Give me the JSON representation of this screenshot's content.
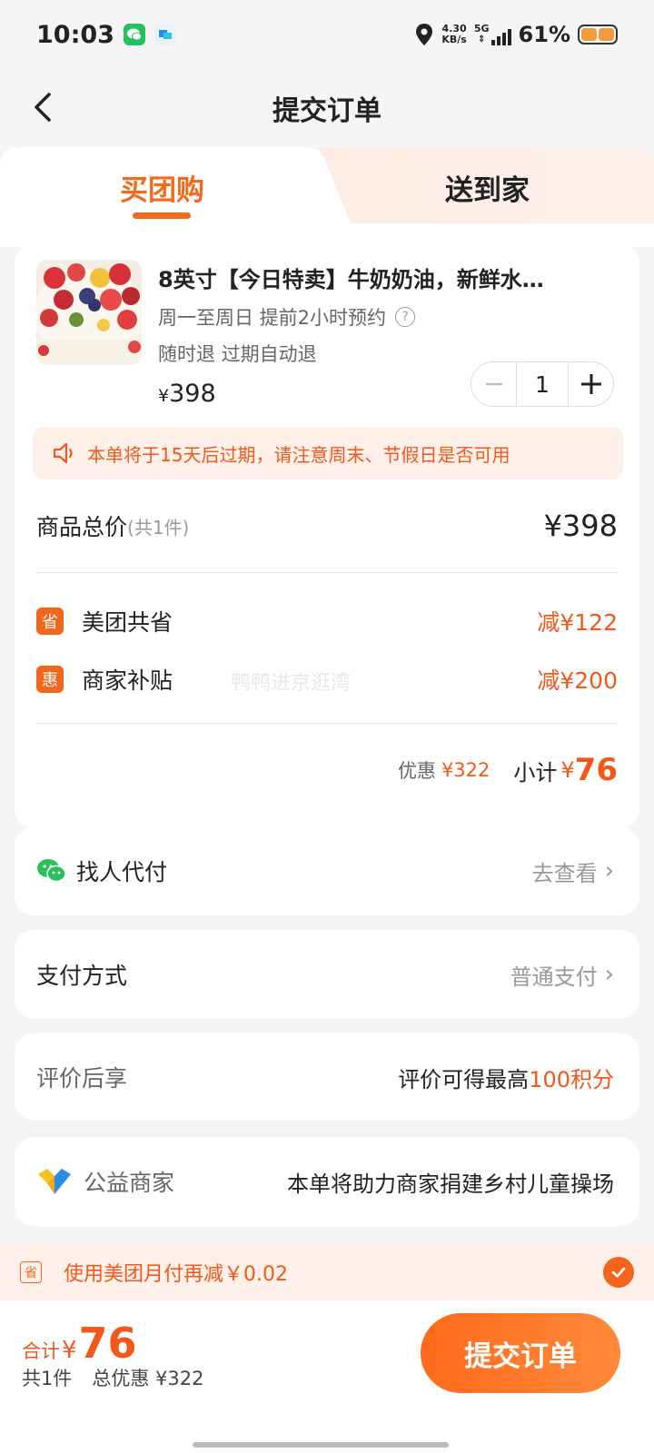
{
  "status_bar": {
    "time": "10:03",
    "net_speed": "4.30",
    "net_unit": "KB/s",
    "signal": "5G",
    "battery": "61%"
  },
  "nav": {
    "title": "提交订单",
    "back_icon": "chevron-left-icon"
  },
  "tabs": [
    {
      "label": "买团购",
      "active": true
    },
    {
      "label": "送到家",
      "active": false
    }
  ],
  "product": {
    "title": "8英寸【今日特卖】牛奶奶油，新鲜水…",
    "schedule": "周一至周日 提前2小时预约",
    "refund": "随时退 过期自动退",
    "price_symbol": "¥",
    "price": "398",
    "quantity": "1"
  },
  "notice": {
    "icon": "speaker-icon",
    "text": "本单将于15天后过期，请注意周末、节假日是否可用"
  },
  "summary": {
    "total_label": "商品总价",
    "total_count": "(共1件)",
    "total_value": "¥398",
    "discounts": [
      {
        "badge": "省",
        "label": "美团共省",
        "value": "减¥122"
      },
      {
        "badge": "惠",
        "label": "商家补贴",
        "value": "减¥200"
      }
    ],
    "watermark": "鸭鸭进京逛湾",
    "discount_label": "优惠",
    "discount_value": "¥322",
    "subtotal_label": "小计",
    "subtotal_symbol": "¥",
    "subtotal_value": "76"
  },
  "pay_other": {
    "label": "找人代付",
    "action": "去查看",
    "icon": "wechat-icon"
  },
  "pay_method": {
    "label": "支付方式",
    "value": "普通支付"
  },
  "review": {
    "label": "评价后享",
    "text_prefix": "评价可得最高",
    "text_highlight": "100积分"
  },
  "charity": {
    "label": "公益商家",
    "text": "本单将助力商家捐建乡村儿童操场",
    "icon": "charity-heart-icon"
  },
  "monthly_pay": {
    "badge": "省",
    "text": "使用美团月付再减￥0.02",
    "checked": true
  },
  "bottom": {
    "total_label": "合计",
    "total_symbol": "¥",
    "total_value": "76",
    "count": "共1件",
    "discount": "总优惠 ¥322",
    "submit": "提交订单"
  },
  "colors": {
    "accent": "#f2581b",
    "button_start": "#ff6a1b",
    "button_end": "#ff8a3a",
    "notice_bg": "#fff0ea",
    "page_bg": "#f5f5f5"
  }
}
